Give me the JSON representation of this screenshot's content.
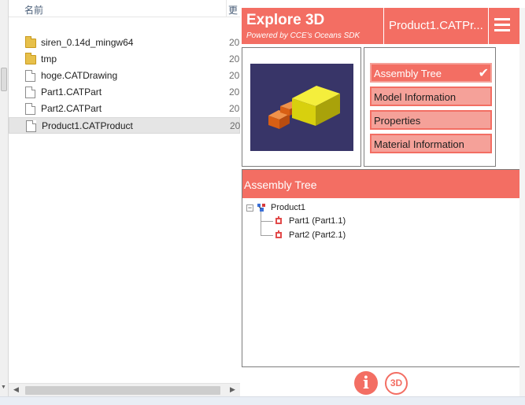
{
  "explorer": {
    "column_name": "名前",
    "column_date": "更",
    "files": [
      {
        "name": "siren_0.14d_mingw64",
        "icon": "folder-icon",
        "date": "20",
        "selected": false
      },
      {
        "name": "tmp",
        "icon": "folder-icon",
        "date": "20",
        "selected": false
      },
      {
        "name": "hoge.CATDrawing",
        "icon": "document-icon",
        "date": "20",
        "selected": false
      },
      {
        "name": "Part1.CATPart",
        "icon": "document-icon",
        "date": "20",
        "selected": false
      },
      {
        "name": "Part2.CATPart",
        "icon": "document-icon",
        "date": "20",
        "selected": false
      },
      {
        "name": "Product1.CATProduct",
        "icon": "document-icon",
        "date": "20",
        "selected": true
      }
    ],
    "scroll_left": "◀",
    "scroll_right": "▶",
    "scroll_down": "▼"
  },
  "app": {
    "title": "Explore 3D",
    "subtitle": "Powered by CCE's Oceans SDK",
    "document": "Product1.CATPr...",
    "menu": [
      {
        "label": "Assembly Tree",
        "active": true
      },
      {
        "label": "Model Information",
        "active": false
      },
      {
        "label": "Properties",
        "active": false
      },
      {
        "label": "Material Information",
        "active": false
      }
    ],
    "check_glyph": "✔",
    "tree_title": "Assembly Tree",
    "tree": {
      "root": "Product1",
      "toggle": "−",
      "children": [
        "Part1 (Part1.1)",
        "Part2 (Part2.1)"
      ]
    },
    "footer": {
      "info": "i",
      "three_d": "3D"
    }
  },
  "colors": {
    "accent": "#f36e63",
    "accent_light": "#f5a199",
    "preview_bg": "#383568",
    "box_yellow": "#e6e014",
    "box_orange": "#e8741e"
  }
}
